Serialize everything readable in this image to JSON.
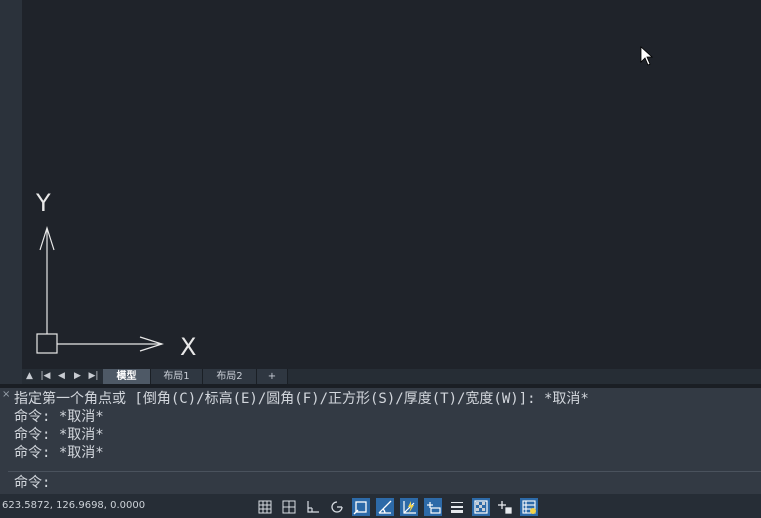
{
  "layout_tabs": {
    "nav": {
      "scroll_up": "▲",
      "first": "|◀",
      "prev": "◀",
      "next": "▶",
      "last": "▶|"
    },
    "items": [
      "模型",
      "布局1",
      "布局2"
    ],
    "add_label": "+"
  },
  "ucs": {
    "x_label": "X",
    "y_label": "Y"
  },
  "command_window": {
    "close_label": "×",
    "history": [
      "指定第一个角点或 [倒角(C)/标高(E)/圆角(F)/正方形(S)/厚度(T)/宽度(W)]: *取消*",
      "命令: *取消*",
      "命令: *取消*",
      "命令: *取消*"
    ],
    "prompt": "命令:",
    "input_value": ""
  },
  "status_bar": {
    "coordinates": "623.5872, 126.9698, 0.0000",
    "toggles": [
      {
        "name": "grid-display",
        "icon": "grid-icon",
        "on": false
      },
      {
        "name": "snap-mode",
        "icon": "snap-grid-icon",
        "on": false
      },
      {
        "name": "ortho-mode",
        "icon": "ortho-icon",
        "on": false
      },
      {
        "name": "polar-tracking",
        "icon": "polar-icon",
        "on": false
      },
      {
        "name": "object-snap",
        "icon": "osnap-icon",
        "on": true
      },
      {
        "name": "object-snap-tracking",
        "icon": "osnap-tracking-icon",
        "on": true
      },
      {
        "name": "dynamic-ucs",
        "icon": "dynamic-ucs-icon",
        "on": true
      },
      {
        "name": "dynamic-input",
        "icon": "dynamic-input-icon",
        "on": true
      },
      {
        "name": "lineweight",
        "icon": "lineweight-icon",
        "on": false
      },
      {
        "name": "transparency",
        "icon": "transparency-icon",
        "on": true
      },
      {
        "name": "selection-cycling",
        "icon": "selection-cycling-icon",
        "on": false
      },
      {
        "name": "annotation-monitor",
        "icon": "annotation-icon",
        "on": true
      }
    ]
  },
  "colors": {
    "canvas": "#1f232a",
    "command_bg": "#333a44",
    "status_bg": "#262d36",
    "toggle_on": "#2d6aa8"
  }
}
